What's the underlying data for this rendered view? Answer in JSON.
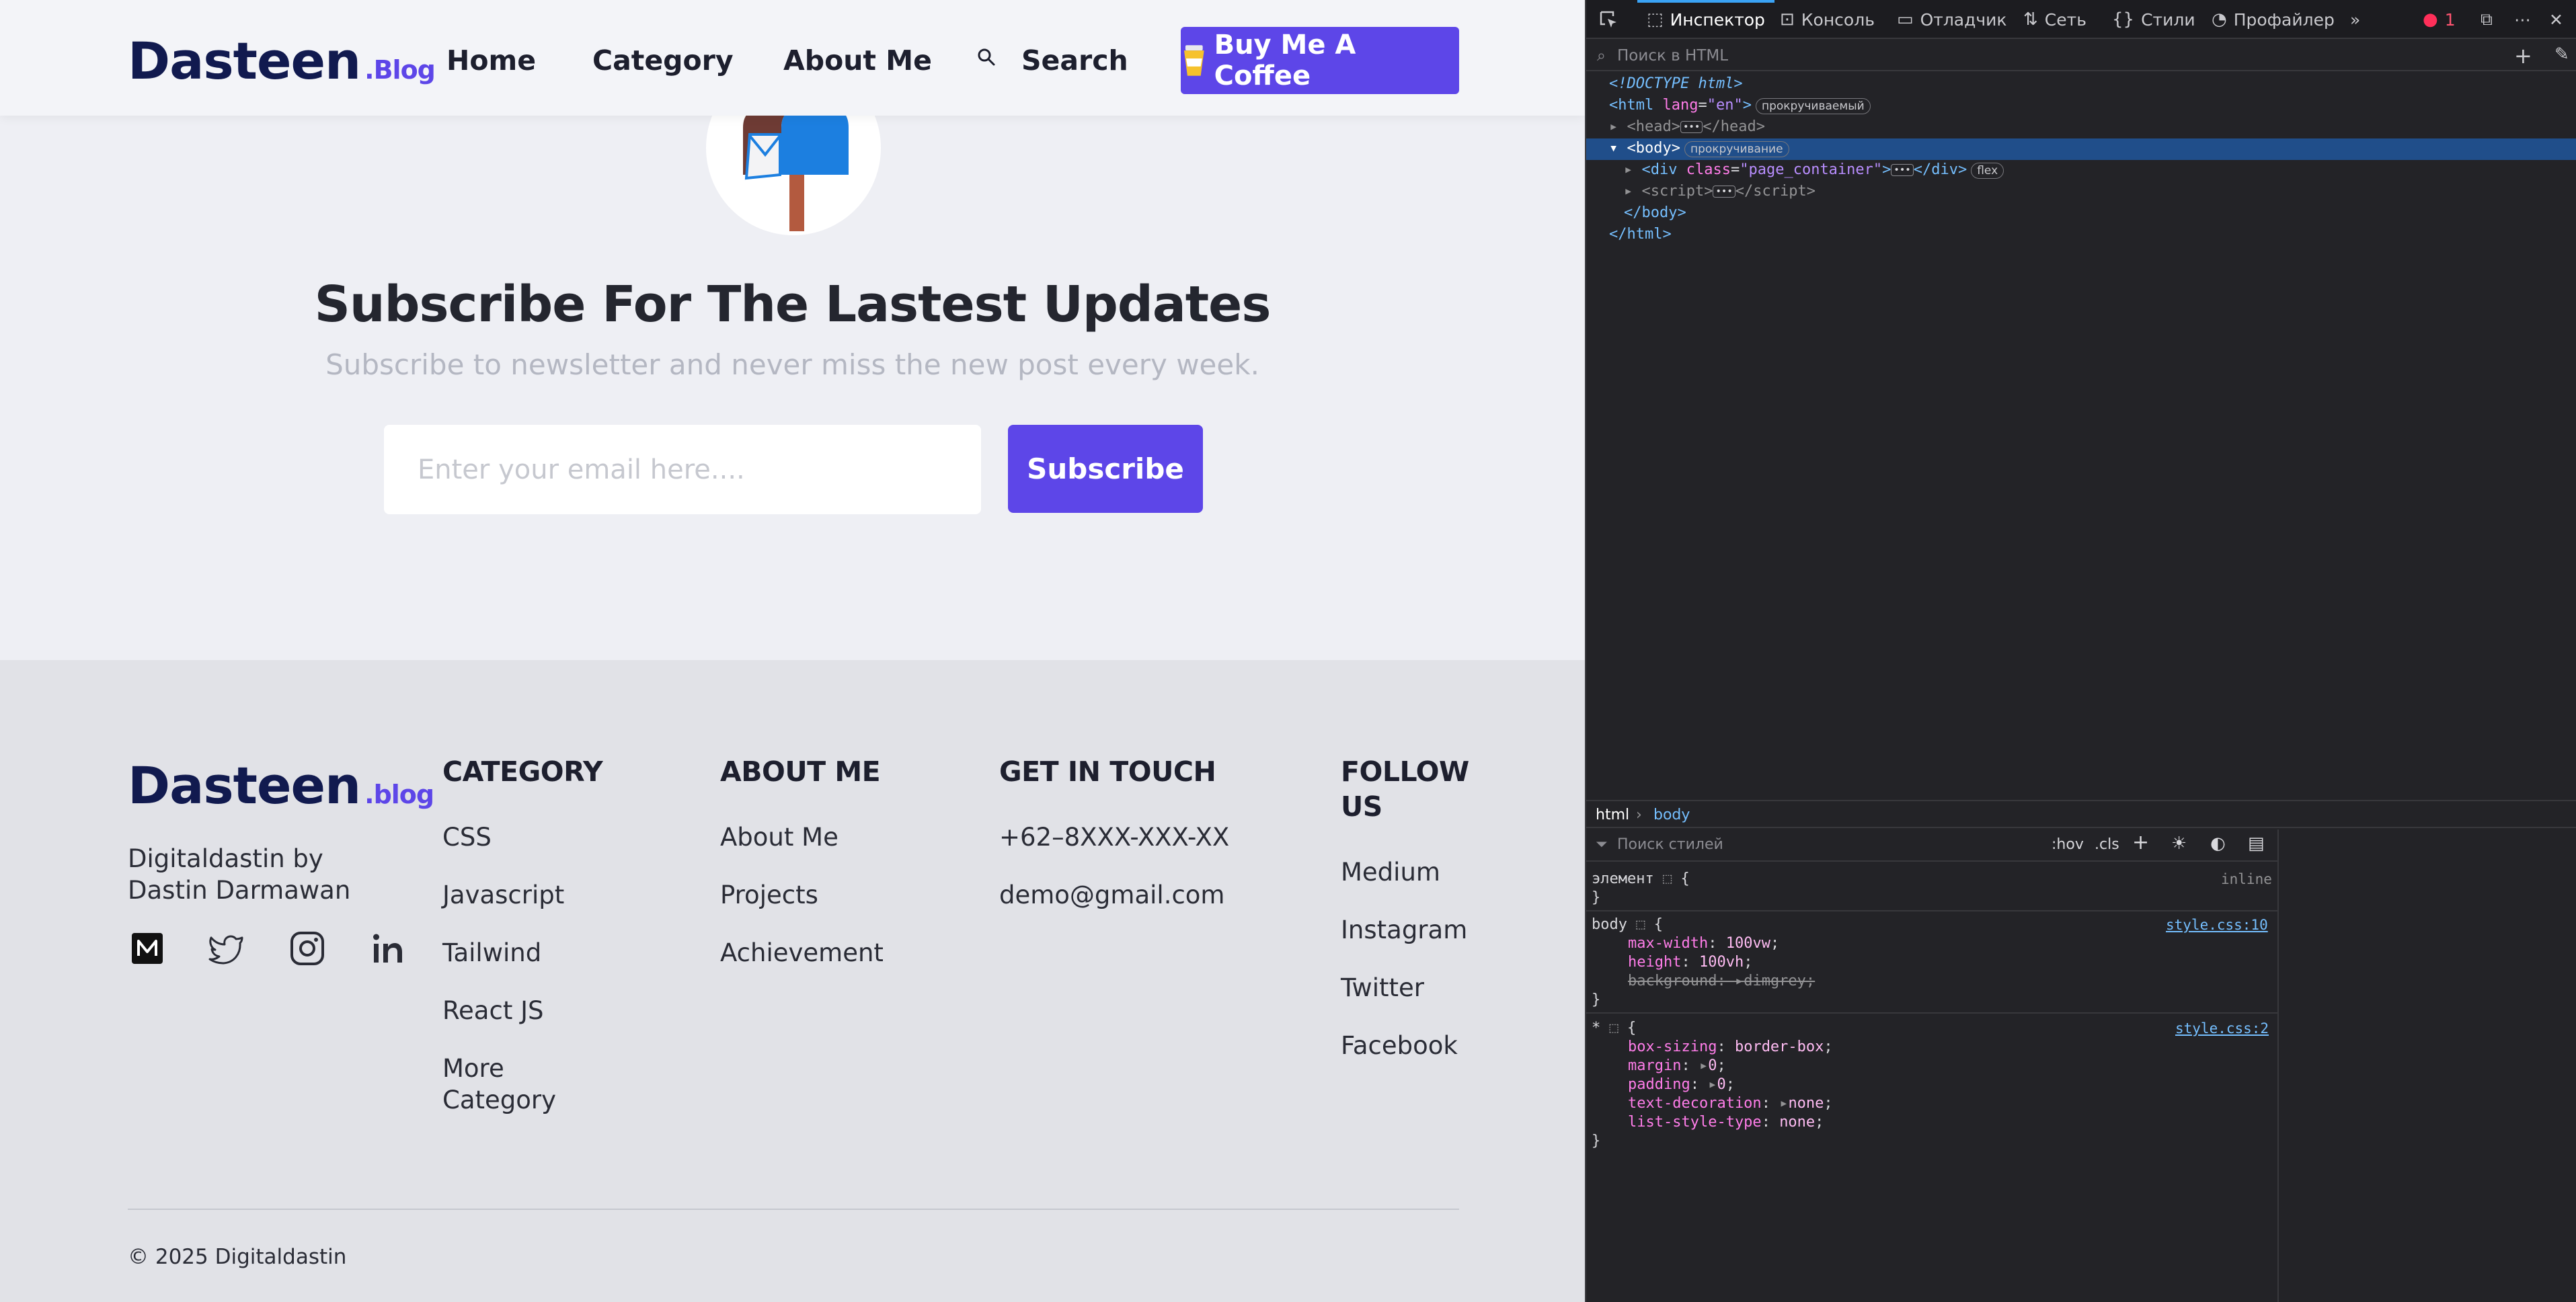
{
  "header": {
    "logo_main": "Dasteen",
    "logo_suffix": ".Blog",
    "nav": [
      "Home",
      "Category",
      "About Me"
    ],
    "search_label": "Search",
    "coffee_label": "Buy Me A Coffee"
  },
  "subscribe": {
    "title": "Subscribe For The Lastest Updates",
    "description": "Subscribe to newsletter and never miss the new post every week.",
    "email_placeholder": "Enter your email here....",
    "button_label": "Subscribe"
  },
  "footer": {
    "logo_main": "Dasteen",
    "logo_suffix": ".blog",
    "tagline": "Digitaldastin by Dastin Darmawan",
    "social_icons": [
      "medium-icon",
      "twitter-icon",
      "instagram-icon",
      "linkedin-icon"
    ],
    "columns": {
      "category": {
        "title": "CATEGORY",
        "items": [
          "CSS",
          "Javascript",
          "Tailwind",
          "React JS",
          "More Category"
        ]
      },
      "about": {
        "title": "ABOUT ME",
        "items": [
          "About Me",
          "Projects",
          "Achievement"
        ]
      },
      "contact": {
        "title": "GET IN TOUCH",
        "items": [
          "+62–8XXX-XXX-XX",
          "demo@gmail.com"
        ]
      },
      "follow": {
        "title": "FOLLOW US",
        "items": [
          "Medium",
          "Instagram",
          "Twitter",
          "Facebook"
        ]
      }
    },
    "copyright": "© 2025 Digitaldastin"
  },
  "devtools": {
    "tabs": [
      "Инспектор",
      "Консоль",
      "Отладчик",
      "Сеть",
      "Стили",
      "Профайлер"
    ],
    "error_count": "1",
    "search_placeholder": "Поиск в HTML",
    "badge_scrollable": "прокручиваемый",
    "badge_scroll": "прокручивание",
    "badge_flex": "flex",
    "tree": {
      "doctype": "<!DOCTYPE html>",
      "html_open": "html",
      "lang_attr": "lang",
      "lang_val": "\"en\"",
      "head": "head",
      "body": "body",
      "div": "div",
      "class_attr": "class",
      "class_val": "\"page_container\"",
      "script": "script",
      "body_close": "</body>",
      "html_close": "</html>"
    },
    "breadcrumb": [
      "html",
      "body"
    ],
    "styles_filter_placeholder": "Поиск стилей",
    "styles_toggles": [
      ":hov",
      ".cls"
    ],
    "rules": {
      "element_selector": "элемент",
      "element_source": "inline",
      "body_selector": "body",
      "body_source": "style.css:10",
      "body_props": [
        {
          "name": "max-width",
          "value": "100vw"
        },
        {
          "name": "height",
          "value": "100vh"
        },
        {
          "name": "background",
          "value": "dimgrey"
        }
      ],
      "star_selector": "*",
      "star_source": "style.css:2",
      "star_props": [
        {
          "name": "box-sizing",
          "value": "border-box"
        },
        {
          "name": "margin",
          "value": "0"
        },
        {
          "name": "padding",
          "value": "0"
        },
        {
          "name": "text-decoration",
          "value": "none"
        },
        {
          "name": "list-style-type",
          "value": "none"
        }
      ]
    }
  },
  "colors": {
    "brand": "#5d46e8",
    "logo": "#111a4f",
    "page_bg": "#eeeff4",
    "footer_bg": "#e1e2e7",
    "devtools_bg": "#232327",
    "devtools_selected": "#204e8a"
  }
}
